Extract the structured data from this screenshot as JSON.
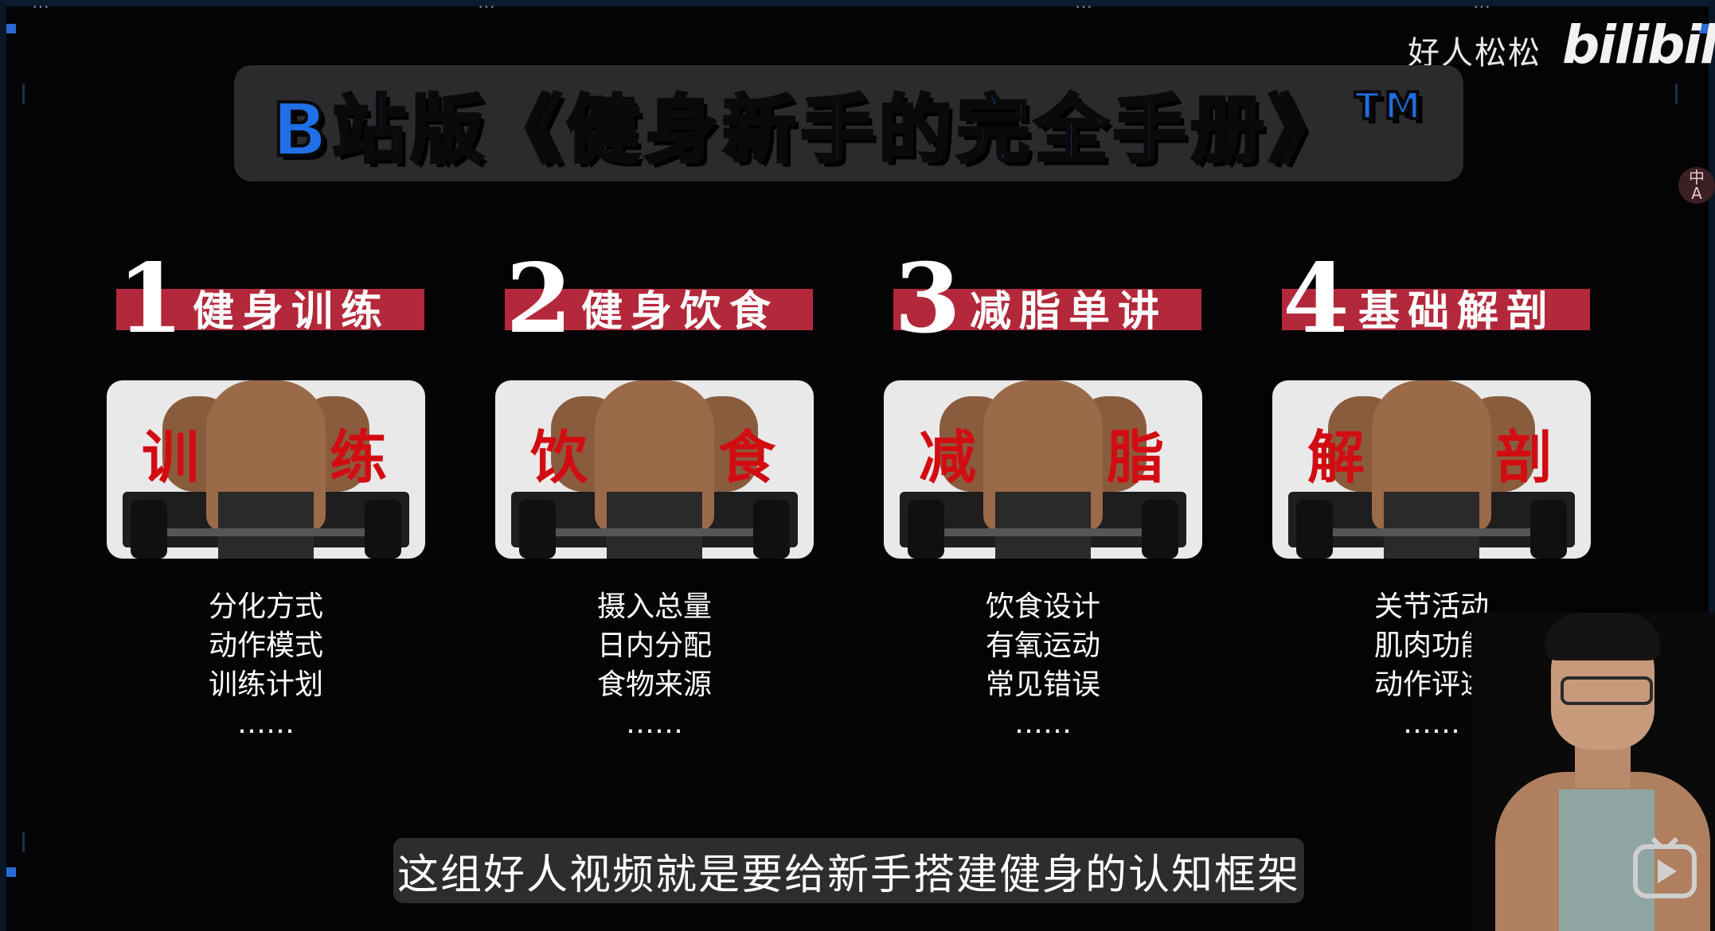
{
  "top_nav": [
    {
      "text": "…"
    },
    {
      "text": "…"
    },
    {
      "text": "…"
    },
    {
      "text": "…"
    }
  ],
  "title": {
    "main": "B站版《健身新手的完全手册》",
    "mark": "TM"
  },
  "watermark": {
    "user": "好人松松",
    "logo": "bilibili"
  },
  "side_badge": {
    "line1": "中",
    "line2": "A"
  },
  "sections": [
    {
      "num": "1",
      "label": "健身训练",
      "card_left": "训",
      "card_right": "练",
      "topics": [
        "分化方式",
        "动作模式",
        "训练计划",
        "……"
      ]
    },
    {
      "num": "2",
      "label": "健身饮食",
      "card_left": "饮",
      "card_right": "食",
      "topics": [
        "摄入总量",
        "日内分配",
        "食物来源",
        "……"
      ]
    },
    {
      "num": "3",
      "label": "减脂单讲",
      "card_left": "减",
      "card_right": "脂",
      "topics": [
        "饮食设计",
        "有氧运动",
        "常见错误",
        "……"
      ]
    },
    {
      "num": "4",
      "label": "基础解剖",
      "card_left": "解",
      "card_right": "剖",
      "topics": [
        "关节活动",
        "肌肉功能",
        "动作评述",
        "……"
      ]
    }
  ],
  "subtitle": "这组好人视频就是要给新手搭建健身的认知框架",
  "colors": {
    "title_blue": "#1f6fe6",
    "section_red": "#b3283b",
    "card_glyph_red": "#d20d12",
    "accent": "#2a6ad6"
  }
}
